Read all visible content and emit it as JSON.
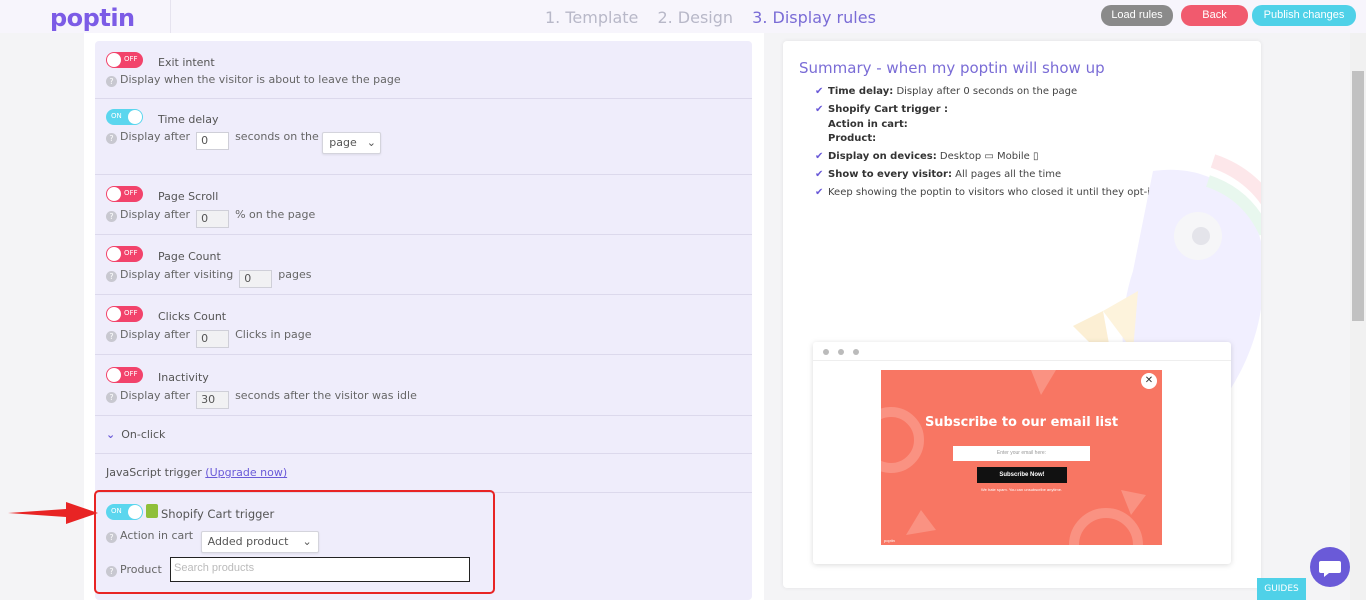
{
  "header": {
    "logo": "poptin",
    "steps": [
      "1. Template",
      "2. Design",
      "3. Display rules"
    ],
    "active_step": 2,
    "buttons": {
      "load_rules": "Load rules",
      "back": "Back",
      "publish": "Publish changes"
    }
  },
  "toggle_labels": {
    "on": "ON",
    "off": "OFF"
  },
  "rules": {
    "exit_intent": {
      "title": "Exit intent",
      "state": "off",
      "desc": "Display when the visitor is about to leave the page"
    },
    "time_delay": {
      "title": "Time delay",
      "state": "on",
      "pre": "Display after",
      "value": "0",
      "post": "seconds on the",
      "select": "page"
    },
    "page_scroll": {
      "title": "Page Scroll",
      "state": "off",
      "pre": "Display after",
      "value": "0",
      "post": "% on the page"
    },
    "page_count": {
      "title": "Page Count",
      "state": "off",
      "pre": "Display after visiting",
      "value": "0",
      "post": "pages"
    },
    "clicks_count": {
      "title": "Clicks Count",
      "state": "off",
      "pre": "Display after",
      "value": "0",
      "post": "Clicks in page"
    },
    "inactivity": {
      "title": "Inactivity",
      "state": "off",
      "pre": "Display after",
      "value": "30",
      "post": "seconds after the visitor was idle"
    },
    "on_click": {
      "label": "On-click"
    },
    "js_trigger": {
      "label": "JavaScript trigger",
      "link": "(Upgrade now)"
    },
    "shopify": {
      "title": "Shopify Cart trigger",
      "state": "on",
      "action_label": "Action in cart",
      "action_value": "Added product",
      "product_label": "Product",
      "product_placeholder": "Search products"
    }
  },
  "summary": {
    "title": "Summary - when my poptin will show up",
    "time_delay_label": "Time delay:",
    "time_delay_text": "Display after 0 seconds on the page",
    "shopify_label": "Shopify Cart trigger :",
    "action_label": "Action in cart:",
    "product_label": "Product:",
    "devices_label": "Display on devices:",
    "devices_desktop": "Desktop",
    "devices_mobile": "Mobile",
    "visitor_label": "Show to every visitor:",
    "visitor_text": "All pages all the time",
    "keep_text": "Keep showing the poptin to visitors who closed it until they opt-in."
  },
  "preview": {
    "title": "Subscribe to our email list",
    "input_placeholder": "Enter your email here:",
    "button": "Subscribe Now!",
    "note": "We hate spam. You can unsubscribe anytime.",
    "brand": "poptin"
  },
  "guides": "GUIDES",
  "colors": {
    "accent": "#7a6cd6",
    "off": "#f2436b",
    "on": "#5bd6ee",
    "popup": "#f87663",
    "highlight": "#e82424"
  }
}
